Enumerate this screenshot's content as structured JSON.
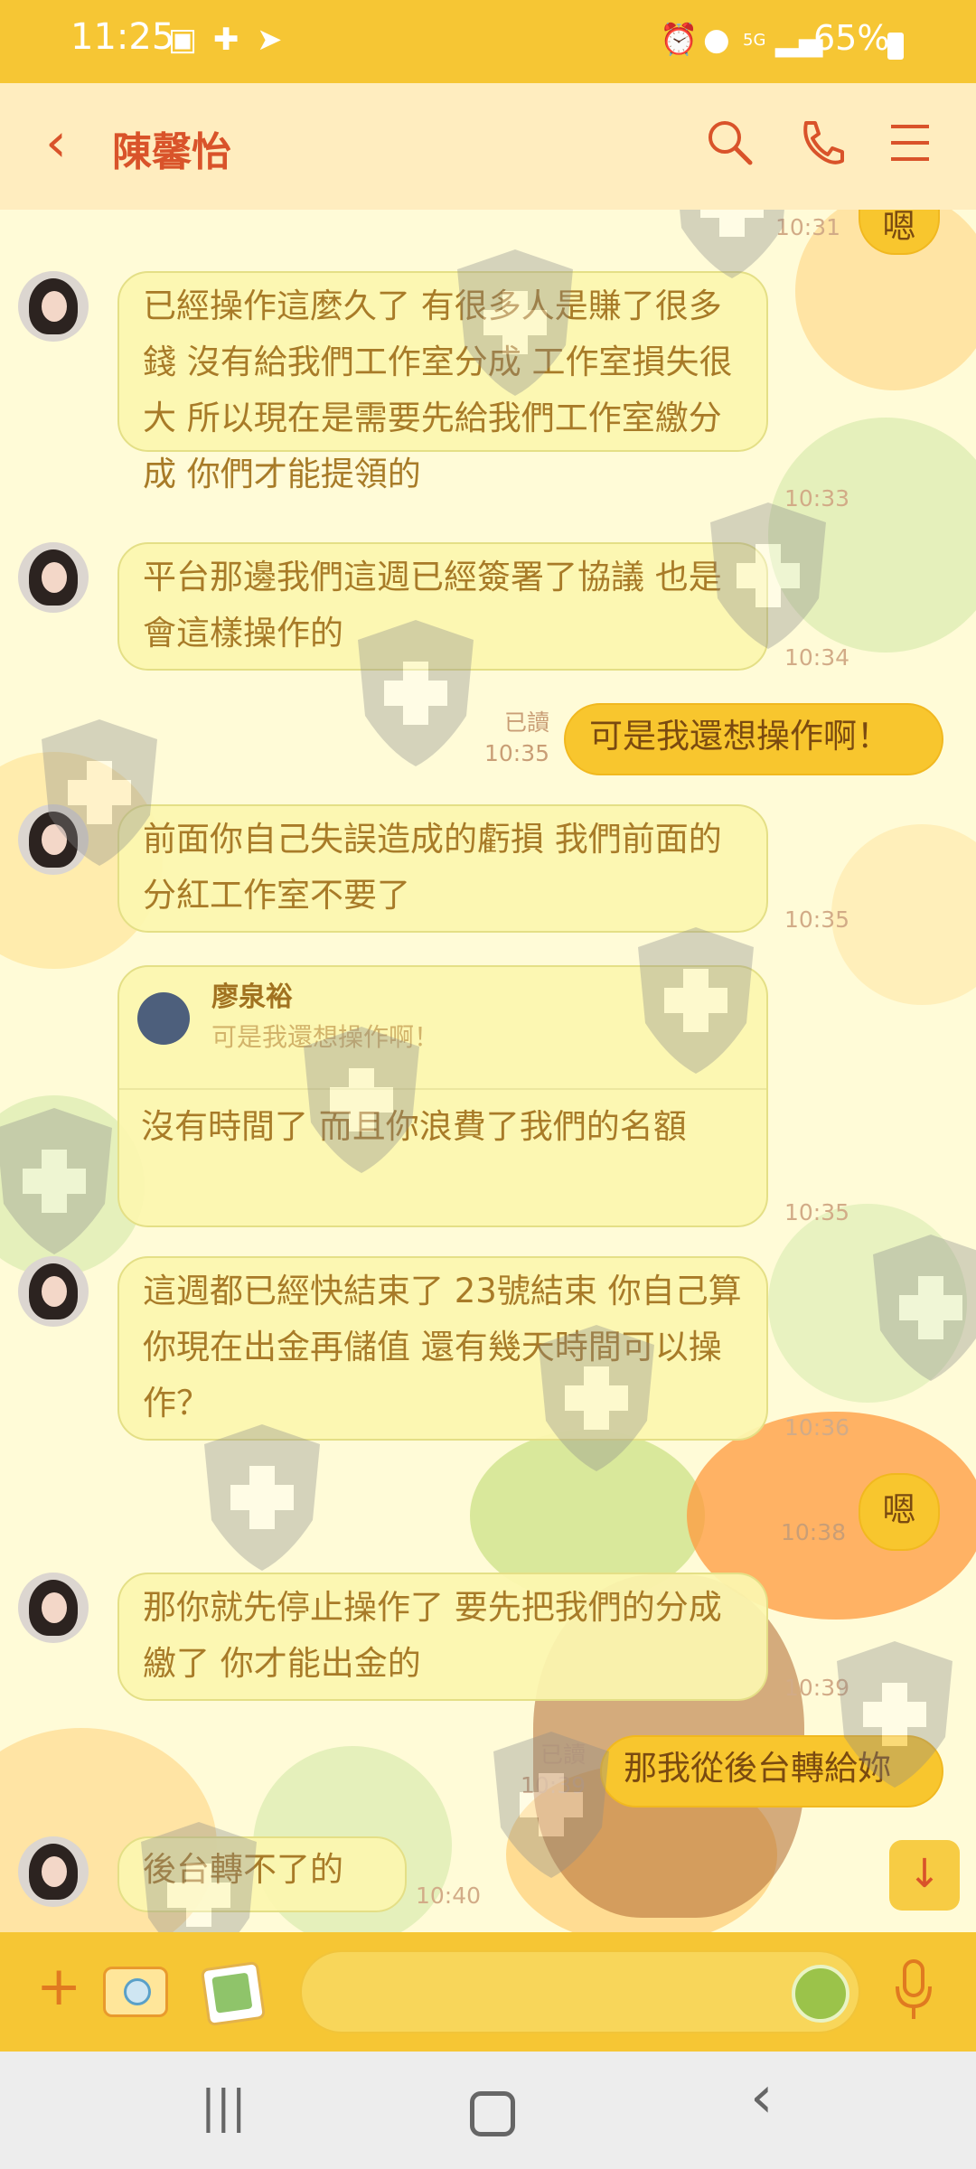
{
  "status_bar": {
    "time": "11:25",
    "network": "5G",
    "battery": "65%"
  },
  "header": {
    "title": "陳馨怡"
  },
  "messages": [
    {
      "side": "other",
      "text": "已經操作這麼久了  有很多人是賺了很多錢  沒有給我們工作室分成  工作室損失很大  所以現在是需要先給我們工作室繳分成  你們才能提領的",
      "time": "10:33"
    },
    {
      "side": "other",
      "text": "平台那邊我們這週已經簽署了協議 也是會這樣操作的",
      "time": "10:34"
    },
    {
      "side": "me",
      "text": "可是我還想操作啊！",
      "read": "已讀",
      "time": "10:35"
    },
    {
      "side": "other",
      "text": "前面你自己失誤造成的虧損 我們前面的分紅工作室不要了",
      "time": "10:35"
    },
    {
      "side": "other",
      "reply_name": "廖泉裕",
      "reply_quote": "可是我還想操作啊！",
      "text": "沒有時間了  而且你浪費了我們的名額",
      "time": "10:35"
    },
    {
      "side": "other",
      "text": "這週都已經快結束了  23號結束  你自己算  你現在出金再儲值  還有幾天時間可以操作？",
      "time": "10:36"
    },
    {
      "side": "me",
      "text": "嗯",
      "time": "10:38"
    },
    {
      "side": "other",
      "text": "那你就先停止操作了   要先把我們的分成繳了 你才能出金的",
      "time": "10:39"
    },
    {
      "side": "me",
      "text": "那我從後台轉給妳",
      "read": "已讀",
      "time": "10:39"
    },
    {
      "side": "other",
      "text": "後台轉不了的",
      "time": "10:40"
    }
  ],
  "top_partial": {
    "time": "10:31",
    "text": "嗯"
  },
  "input": {
    "placeholder": ""
  },
  "colors": {
    "accent": "#f6c634",
    "title": "#d9532a",
    "bubble_other": "#fcf6af",
    "bubble_me": "#f8c62e"
  }
}
